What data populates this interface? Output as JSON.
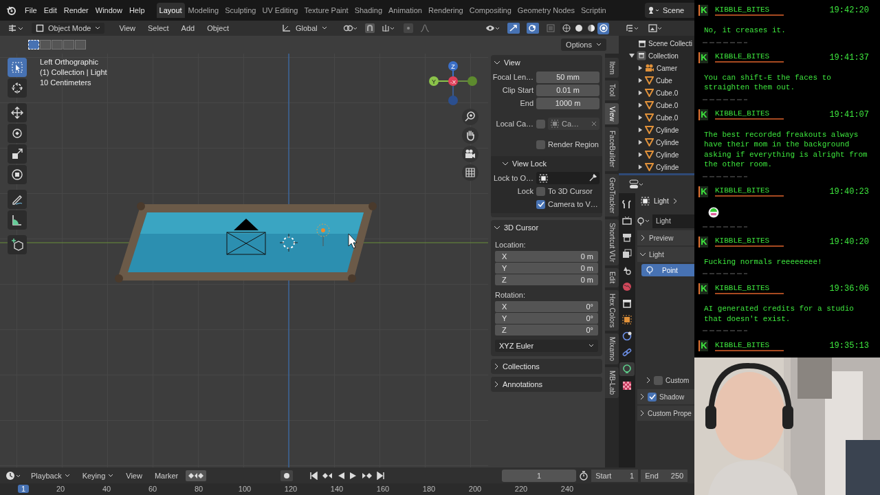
{
  "topbar": {
    "menus": [
      "File",
      "Edit",
      "Render",
      "Window",
      "Help"
    ],
    "workspaces": [
      {
        "label": "Layout",
        "selected": true
      },
      {
        "label": "Modeling",
        "selected": false
      },
      {
        "label": "Sculpting",
        "selected": false
      },
      {
        "label": "UV Editing",
        "selected": false
      },
      {
        "label": "Texture Paint",
        "selected": false
      },
      {
        "label": "Shading",
        "selected": false
      },
      {
        "label": "Animation",
        "selected": false
      },
      {
        "label": "Rendering",
        "selected": false
      },
      {
        "label": "Compositing",
        "selected": false
      },
      {
        "label": "Geometry Nodes",
        "selected": false
      },
      {
        "label": "Scriptin",
        "selected": false
      }
    ],
    "scene": "Scene"
  },
  "header": {
    "mode": "Object Mode",
    "menus": [
      "View",
      "Select",
      "Add",
      "Object"
    ],
    "orientation": "Global",
    "shading": [
      {
        "kind": "wireframe",
        "selected": false
      },
      {
        "kind": "solid",
        "selected": false
      },
      {
        "kind": "material",
        "selected": false
      },
      {
        "kind": "rendered",
        "selected": true
      }
    ],
    "select_modes": [
      {
        "selected": true
      },
      {
        "selected": false
      },
      {
        "selected": false
      },
      {
        "selected": false
      },
      {
        "selected": false
      }
    ],
    "options": "Options"
  },
  "viewport": {
    "overlay_lines": [
      "Left Orthographic",
      "(1) Collection | Light",
      "10 Centimeters"
    ],
    "gizmo": {
      "z": "Z",
      "y": "Y",
      "x": "-X"
    },
    "tools": [
      {
        "kind": "select",
        "selected": true
      },
      {
        "kind": "cursor",
        "selected": false
      },
      {
        "kind": "move",
        "selected": false
      },
      {
        "kind": "rotate",
        "selected": false
      },
      {
        "kind": "scale",
        "selected": false
      },
      {
        "kind": "transform",
        "selected": false
      },
      {
        "kind": "annotate",
        "selected": false
      },
      {
        "kind": "measure",
        "selected": false
      },
      {
        "kind": "add-cube",
        "selected": false
      }
    ]
  },
  "sidebar": {
    "view": {
      "title": "View",
      "fields": [
        {
          "label": "Focal Len…",
          "value": "50 mm"
        },
        {
          "label": "Clip Start",
          "value": "0.01 m"
        },
        {
          "label": "End",
          "value": "1000 m"
        }
      ],
      "local_camera": {
        "label": "Local Ca…",
        "checked": false,
        "value": "Ca…"
      },
      "render_region": {
        "label": "Render Region",
        "checked": false
      },
      "view_lock": {
        "title": "View Lock",
        "lock_to_object": "Lock to O…",
        "lock": "Lock",
        "to_3d_cursor": {
          "label": "To 3D Cursor",
          "checked": false
        },
        "camera_to_view": {
          "label": "Camera to V…",
          "checked": true
        }
      }
    },
    "cursor": {
      "title": "3D Cursor",
      "location_label": "Location:",
      "location": [
        {
          "axis": "X",
          "value": "0 m"
        },
        {
          "axis": "Y",
          "value": "0 m"
        },
        {
          "axis": "Z",
          "value": "0 m"
        }
      ],
      "rotation_label": "Rotation:",
      "rotation": [
        {
          "axis": "X",
          "value": "0°"
        },
        {
          "axis": "Y",
          "value": "0°"
        },
        {
          "axis": "Z",
          "value": "0°"
        }
      ],
      "rotation_mode": "XYZ Euler"
    },
    "collapsed": [
      "Collections",
      "Annotations"
    ]
  },
  "tabs": [
    {
      "label": "Item",
      "selected": false
    },
    {
      "label": "Tool",
      "selected": false
    },
    {
      "label": "View",
      "selected": true
    },
    {
      "label": "FaceBuilder",
      "selected": false
    },
    {
      "label": "GeoTracker",
      "selected": false
    },
    {
      "label": "Shortcut VUr",
      "selected": false
    },
    {
      "label": "Edit",
      "selected": false
    },
    {
      "label": "Hex Colors",
      "selected": false
    },
    {
      "label": "Mixamo",
      "selected": false
    },
    {
      "label": "MB-Lab",
      "selected": false
    }
  ],
  "outliner": {
    "label": "Scene Collecti",
    "children": [
      {
        "label": "Collection",
        "expanded": true,
        "children": [
          {
            "label": "Camer",
            "kind": "camera",
            "expanded": false
          },
          {
            "label": "Cube",
            "kind": "mesh",
            "expanded": false
          },
          {
            "label": "Cube.0",
            "kind": "mesh",
            "expanded": false
          },
          {
            "label": "Cube.0",
            "kind": "mesh",
            "expanded": false
          },
          {
            "label": "Cube.0",
            "kind": "mesh",
            "expanded": false
          },
          {
            "label": "Cylinde",
            "kind": "mesh",
            "expanded": false
          },
          {
            "label": "Cylinde",
            "kind": "mesh",
            "expanded": false
          },
          {
            "label": "Cylinde",
            "kind": "mesh",
            "expanded": false
          },
          {
            "label": "Cylinde",
            "kind": "mesh",
            "expanded": false
          }
        ]
      }
    ]
  },
  "properties": {
    "tabs": [
      {
        "kind": "tool",
        "selected": false
      },
      {
        "kind": "render",
        "selected": false
      },
      {
        "kind": "output",
        "selected": false
      },
      {
        "kind": "view-layer",
        "selected": false
      },
      {
        "kind": "scene",
        "selected": false
      },
      {
        "kind": "world",
        "selected": false
      },
      {
        "kind": "collection",
        "selected": false
      },
      {
        "kind": "object",
        "selected": false
      },
      {
        "kind": "physics",
        "selected": false
      },
      {
        "kind": "constraints",
        "selected": false
      },
      {
        "kind": "light",
        "selected": true
      },
      {
        "kind": "texture",
        "selected": false
      }
    ],
    "breadcrumb": "Light",
    "datablock": "Light",
    "panels": [
      {
        "label": "Preview",
        "expanded": false
      },
      {
        "label": "Light",
        "expanded": true
      }
    ],
    "light_types": [
      {
        "label": "Point",
        "selected": true
      }
    ],
    "custom": {
      "label": "Custom",
      "checked": false
    },
    "shadow": {
      "label": "Shadow",
      "checked": true
    },
    "custom_props": "Custom Prope"
  },
  "timeline": {
    "menus": [
      "Playback",
      "Keying",
      "View",
      "Marker"
    ],
    "current_frame": "1",
    "start_label": "Start",
    "start": "1",
    "end_label": "End",
    "end": "250",
    "ruler": [
      "1",
      "20",
      "40",
      "60",
      "80",
      "100",
      "120",
      "140",
      "160",
      "180",
      "200",
      "220",
      "240"
    ]
  },
  "chat": {
    "messages": [
      {
        "badge": "K",
        "user": "KIBBLE_BITES",
        "time": "19:42:20",
        "kind": "text",
        "text": "No, it creases it."
      },
      {
        "badge": "K",
        "user": "KIBBLE_BITES",
        "time": "19:41:37",
        "kind": "text",
        "text": "You can shift-E the faces to straighten them out."
      },
      {
        "badge": "K",
        "user": "KIBBLE_BITES",
        "time": "19:41:07",
        "kind": "text",
        "text": "The best recorded freakouts always have their mom in the background asking if everything is alright from the other room."
      },
      {
        "badge": "K",
        "user": "KIBBLE_BITES",
        "time": "19:40:23",
        "kind": "emote"
      },
      {
        "badge": "K",
        "user": "KIBBLE_BITES",
        "time": "19:40:20",
        "kind": "text",
        "text": "Fucking normals reeeeeeee!"
      },
      {
        "badge": "K",
        "user": "KIBBLE_BITES",
        "time": "19:36:06",
        "kind": "text",
        "text": "AI generated credits for a studio that doesn't exist."
      },
      {
        "badge": "K",
        "user": "KIBBLE_BITES",
        "time": "19:35:13",
        "kind": "none"
      }
    ]
  }
}
